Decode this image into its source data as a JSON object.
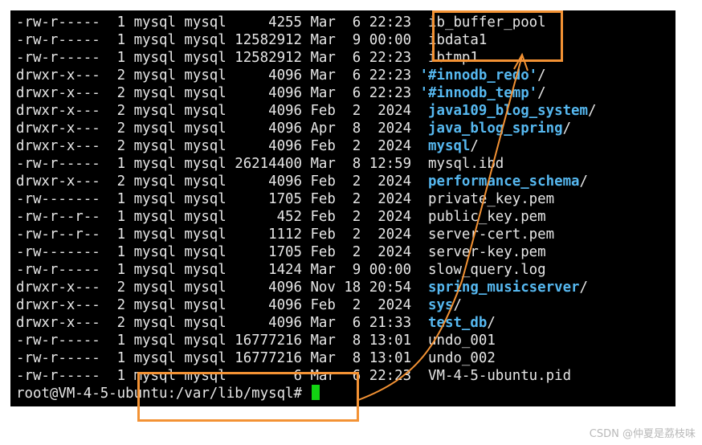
{
  "terminal": {
    "entries": [
      {
        "perms": "-rw-r-----",
        "links": "1",
        "owner": "mysql",
        "group": "mysql",
        "size": "4255",
        "month": "Mar",
        "day": "6",
        "time": "22:23",
        "name": "ib_buffer_pool",
        "is_dir": false
      },
      {
        "perms": "-rw-r-----",
        "links": "1",
        "owner": "mysql",
        "group": "mysql",
        "size": "12582912",
        "month": "Mar",
        "day": "9",
        "time": "00:00",
        "name": "ibdata1",
        "is_dir": false
      },
      {
        "perms": "-rw-r-----",
        "links": "1",
        "owner": "mysql",
        "group": "mysql",
        "size": "12582912",
        "month": "Mar",
        "day": "6",
        "time": "22:23",
        "name": "ibtmp1",
        "is_dir": false
      },
      {
        "perms": "drwxr-x---",
        "links": "2",
        "owner": "mysql",
        "group": "mysql",
        "size": "4096",
        "month": "Mar",
        "day": "6",
        "time": "22:23",
        "name": "'#innodb_redo'",
        "is_dir": true
      },
      {
        "perms": "drwxr-x---",
        "links": "2",
        "owner": "mysql",
        "group": "mysql",
        "size": "4096",
        "month": "Mar",
        "day": "6",
        "time": "22:23",
        "name": "'#innodb_temp'",
        "is_dir": true
      },
      {
        "perms": "drwxr-x---",
        "links": "2",
        "owner": "mysql",
        "group": "mysql",
        "size": "4096",
        "month": "Feb",
        "day": "2",
        "time": "2024",
        "name": "java109_blog_system",
        "is_dir": true
      },
      {
        "perms": "drwxr-x---",
        "links": "2",
        "owner": "mysql",
        "group": "mysql",
        "size": "4096",
        "month": "Apr",
        "day": "8",
        "time": "2024",
        "name": "java_blog_spring",
        "is_dir": true
      },
      {
        "perms": "drwxr-x---",
        "links": "2",
        "owner": "mysql",
        "group": "mysql",
        "size": "4096",
        "month": "Feb",
        "day": "2",
        "time": "2024",
        "name": "mysql",
        "is_dir": true
      },
      {
        "perms": "-rw-r-----",
        "links": "1",
        "owner": "mysql",
        "group": "mysql",
        "size": "26214400",
        "month": "Mar",
        "day": "8",
        "time": "12:59",
        "name": "mysql.ibd",
        "is_dir": false
      },
      {
        "perms": "drwxr-x---",
        "links": "2",
        "owner": "mysql",
        "group": "mysql",
        "size": "4096",
        "month": "Feb",
        "day": "2",
        "time": "2024",
        "name": "performance_schema",
        "is_dir": true
      },
      {
        "perms": "-rw-------",
        "links": "1",
        "owner": "mysql",
        "group": "mysql",
        "size": "1705",
        "month": "Feb",
        "day": "2",
        "time": "2024",
        "name": "private_key.pem",
        "is_dir": false
      },
      {
        "perms": "-rw-r--r--",
        "links": "1",
        "owner": "mysql",
        "group": "mysql",
        "size": "452",
        "month": "Feb",
        "day": "2",
        "time": "2024",
        "name": "public_key.pem",
        "is_dir": false
      },
      {
        "perms": "-rw-r--r--",
        "links": "1",
        "owner": "mysql",
        "group": "mysql",
        "size": "1112",
        "month": "Feb",
        "day": "2",
        "time": "2024",
        "name": "server-cert.pem",
        "is_dir": false
      },
      {
        "perms": "-rw-------",
        "links": "1",
        "owner": "mysql",
        "group": "mysql",
        "size": "1705",
        "month": "Feb",
        "day": "2",
        "time": "2024",
        "name": "server-key.pem",
        "is_dir": false
      },
      {
        "perms": "-rw-r-----",
        "links": "1",
        "owner": "mysql",
        "group": "mysql",
        "size": "1424",
        "month": "Mar",
        "day": "9",
        "time": "00:00",
        "name": "slow_query.log",
        "is_dir": false
      },
      {
        "perms": "drwxr-x---",
        "links": "2",
        "owner": "mysql",
        "group": "mysql",
        "size": "4096",
        "month": "Nov",
        "day": "18",
        "time": "20:54",
        "name": "spring_musicserver",
        "is_dir": true
      },
      {
        "perms": "drwxr-x---",
        "links": "2",
        "owner": "mysql",
        "group": "mysql",
        "size": "4096",
        "month": "Feb",
        "day": "2",
        "time": "2024",
        "name": "sys",
        "is_dir": true
      },
      {
        "perms": "drwxr-x---",
        "links": "2",
        "owner": "mysql",
        "group": "mysql",
        "size": "4096",
        "month": "Mar",
        "day": "6",
        "time": "21:33",
        "name": "test_db",
        "is_dir": true
      },
      {
        "perms": "-rw-r-----",
        "links": "1",
        "owner": "mysql",
        "group": "mysql",
        "size": "16777216",
        "month": "Mar",
        "day": "8",
        "time": "13:01",
        "name": "undo_001",
        "is_dir": false
      },
      {
        "perms": "-rw-r-----",
        "links": "1",
        "owner": "mysql",
        "group": "mysql",
        "size": "16777216",
        "month": "Mar",
        "day": "8",
        "time": "13:01",
        "name": "undo_002",
        "is_dir": false
      },
      {
        "perms": "-rw-r-----",
        "links": "1",
        "owner": "mysql",
        "group": "mysql",
        "size": "6",
        "month": "Mar",
        "day": "6",
        "time": "22:23",
        "name": "VM-4-5-ubuntu.pid",
        "is_dir": false
      }
    ],
    "prompt": "root@VM-4-5-ubuntu:/var/lib/mysql#"
  },
  "colors": {
    "background": "#000000",
    "text": "#e6e6e6",
    "directory": "#56b8f0",
    "cursor": "#12d312",
    "annotation": "#f39234"
  },
  "watermark": "CSDN @仲夏是荔枝味"
}
